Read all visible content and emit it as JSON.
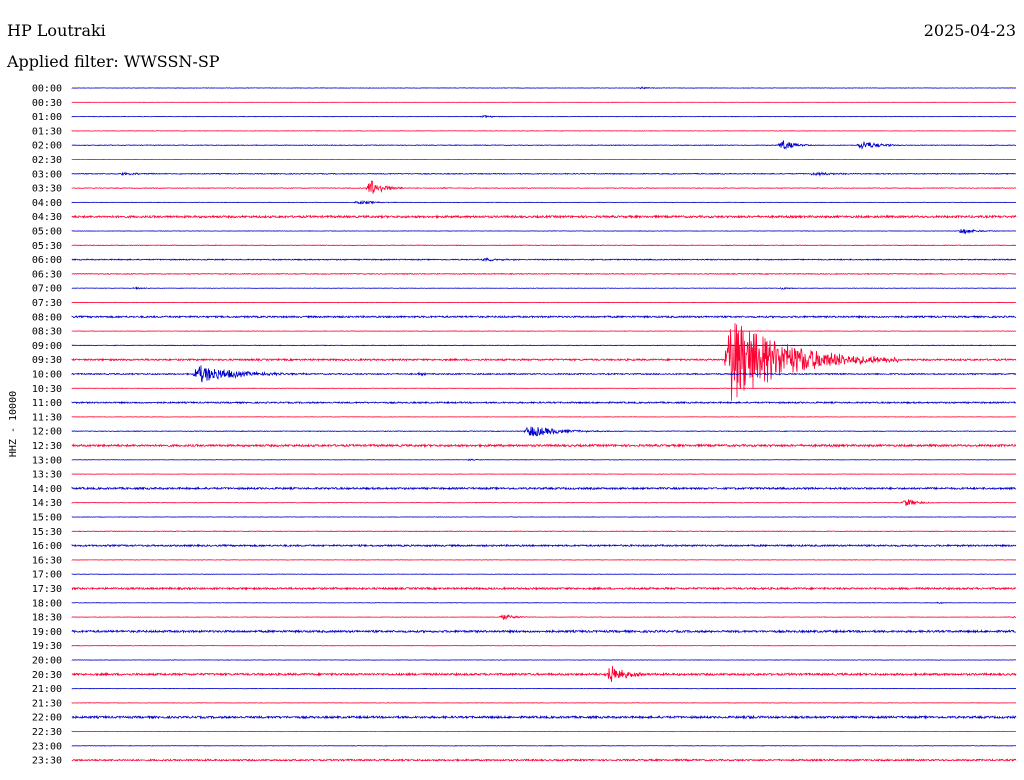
{
  "header": {
    "station": "HP Loutraki",
    "date": "2025-04-23",
    "filter_label": "Applied filter: WWSSN-SP"
  },
  "colors": {
    "even_trace": "#0000cc",
    "odd_trace": "#ff0033",
    "text": "#000000"
  },
  "chart_data": {
    "type": "line",
    "ylabel": "HHZ - 10000",
    "trace_interval_minutes": 30,
    "tick_labels": [
      "00:00",
      "00:30",
      "01:00",
      "01:30",
      "02:00",
      "02:30",
      "03:00",
      "03:30",
      "04:00",
      "04:30",
      "05:00",
      "05:30",
      "06:00",
      "06:30",
      "07:00",
      "07:30",
      "08:00",
      "08:30",
      "09:00",
      "09:30",
      "10:00",
      "10:30",
      "11:00",
      "11:30",
      "12:00",
      "12:30",
      "13:00",
      "13:30",
      "14:00",
      "14:30",
      "15:00",
      "15:30",
      "16:00",
      "16:30",
      "17:00",
      "17:30",
      "18:00",
      "18:30",
      "19:00",
      "19:30",
      "20:00",
      "20:30",
      "21:00",
      "21:30",
      "22:00",
      "22:30",
      "23:00",
      "23:30"
    ],
    "row_noise_levels": [
      0.2,
      0.1,
      0.2,
      0.2,
      0.3,
      0.1,
      0.4,
      0.3,
      0.2,
      1.0,
      0.2,
      0.3,
      0.5,
      0.4,
      0.2,
      0.2,
      0.8,
      0.2,
      0.3,
      0.8,
      0.6,
      0.2,
      0.7,
      0.2,
      0.3,
      1.0,
      0.2,
      0.2,
      0.9,
      0.2,
      0.2,
      0.3,
      0.8,
      0.2,
      0.2,
      0.9,
      0.2,
      0.2,
      1.0,
      0.2,
      0.2,
      1.0,
      0.2,
      0.2,
      1.0,
      0.2,
      0.2,
      0.8
    ],
    "events": [
      {
        "trace": "00:00",
        "minute": 18,
        "amplitude": 1.5,
        "duration_minutes": 1
      },
      {
        "trace": "01:00",
        "minute": 13,
        "amplitude": 2,
        "duration_minutes": 1
      },
      {
        "trace": "02:00",
        "minute": 22.5,
        "amplitude": 8,
        "duration_minutes": 1
      },
      {
        "trace": "02:00",
        "minute": 25,
        "amplitude": 6,
        "duration_minutes": 1.5
      },
      {
        "trace": "02:00",
        "minute": 29,
        "amplitude": 1.5,
        "duration_minutes": 0.5
      },
      {
        "trace": "03:00",
        "minute": 1.5,
        "amplitude": 1.5,
        "duration_minutes": 2
      },
      {
        "trace": "03:00",
        "minute": 23.5,
        "amplitude": 2,
        "duration_minutes": 2
      },
      {
        "trace": "03:30",
        "minute": 9.4,
        "amplitude": 12,
        "duration_minutes": 1.2
      },
      {
        "trace": "03:30",
        "minute": 11.8,
        "amplitude": 2,
        "duration_minutes": 0.4
      },
      {
        "trace": "04:00",
        "minute": 9,
        "amplitude": 2.5,
        "duration_minutes": 1.5
      },
      {
        "trace": "05:00",
        "minute": 28.2,
        "amplitude": 4,
        "duration_minutes": 1.3
      },
      {
        "trace": "06:00",
        "minute": 13,
        "amplitude": 1.5,
        "duration_minutes": 2
      },
      {
        "trace": "06:00",
        "minute": 30,
        "amplitude": 3.5,
        "duration_minutes": 1
      },
      {
        "trace": "07:00",
        "minute": 2,
        "amplitude": 2,
        "duration_minutes": 0.5
      },
      {
        "trace": "07:00",
        "minute": 22.5,
        "amplitude": 2,
        "duration_minutes": 0.7
      },
      {
        "trace": "09:30",
        "minute": 20.8,
        "amplitude": 48,
        "duration_minutes": 5.5
      },
      {
        "trace": "10:00",
        "minute": 3.9,
        "amplitude": 10,
        "duration_minutes": 3.5
      },
      {
        "trace": "10:00",
        "minute": 11,
        "amplitude": 2,
        "duration_minutes": 0.5
      },
      {
        "trace": "12:00",
        "minute": 14.4,
        "amplitude": 7,
        "duration_minutes": 2.8
      },
      {
        "trace": "13:00",
        "minute": 12.6,
        "amplitude": 2,
        "duration_minutes": 0.5
      },
      {
        "trace": "14:30",
        "minute": 26.4,
        "amplitude": 6,
        "duration_minutes": 1
      },
      {
        "trace": "18:00",
        "minute": 27.5,
        "amplitude": 2,
        "duration_minutes": 0.3
      },
      {
        "trace": "18:30",
        "minute": 13.6,
        "amplitude": 4,
        "duration_minutes": 1.2
      },
      {
        "trace": "18:30",
        "minute": 29.8,
        "amplitude": 2,
        "duration_minutes": 0.5
      },
      {
        "trace": "20:30",
        "minute": 17,
        "amplitude": 13,
        "duration_minutes": 1.3
      },
      {
        "trace": "22:00",
        "minute": 21.5,
        "amplitude": 2,
        "duration_minutes": 0.7
      }
    ]
  }
}
